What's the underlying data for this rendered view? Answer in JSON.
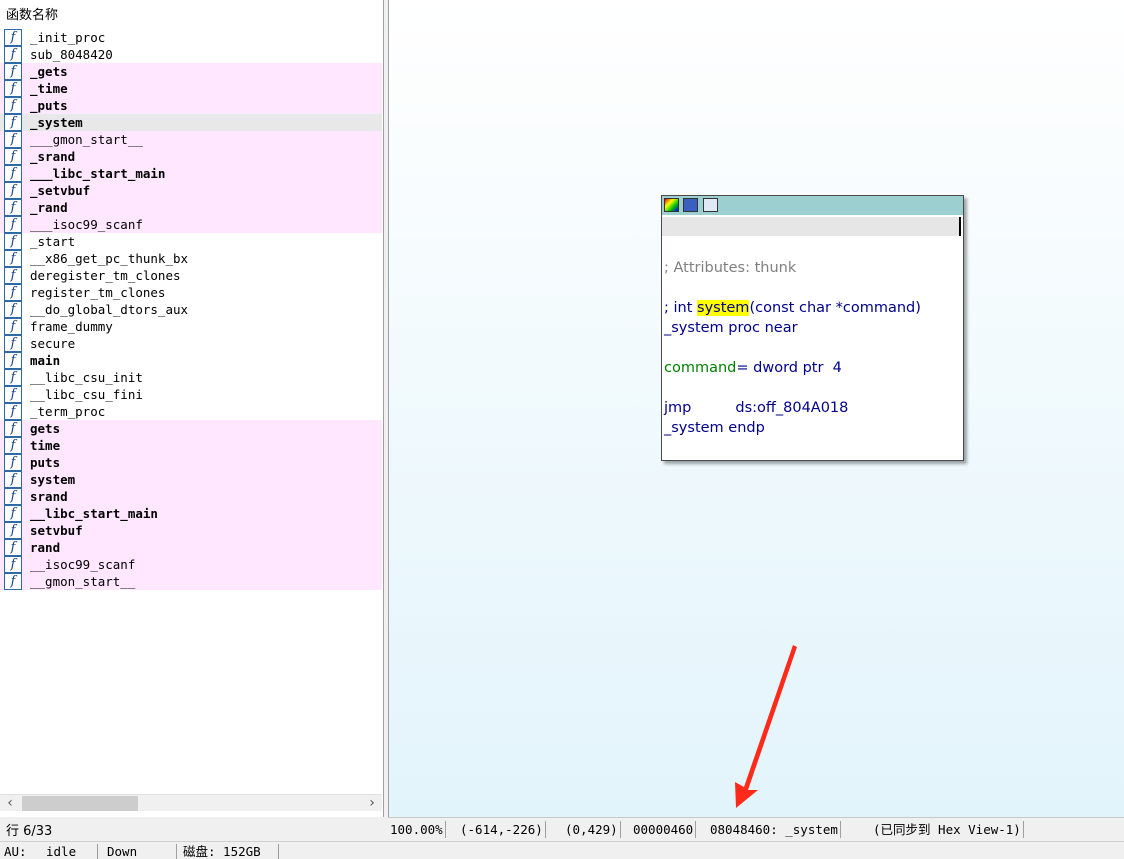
{
  "functions_panel": {
    "title": "函数名称",
    "row_indicator": "行 6/33",
    "items": [
      {
        "name": "_init_proc",
        "bold": false,
        "pink": false
      },
      {
        "name": "sub_8048420",
        "bold": false,
        "pink": false
      },
      {
        "name": "_gets",
        "bold": true,
        "pink": true
      },
      {
        "name": "_time",
        "bold": true,
        "pink": true
      },
      {
        "name": "_puts",
        "bold": true,
        "pink": true
      },
      {
        "name": "_system",
        "bold": true,
        "pink": true,
        "selected": true
      },
      {
        "name": "___gmon_start__",
        "bold": false,
        "pink": true
      },
      {
        "name": "_srand",
        "bold": true,
        "pink": true
      },
      {
        "name": "___libc_start_main",
        "bold": true,
        "pink": true
      },
      {
        "name": "_setvbuf",
        "bold": true,
        "pink": true
      },
      {
        "name": "_rand",
        "bold": true,
        "pink": true
      },
      {
        "name": "___isoc99_scanf",
        "bold": false,
        "pink": true
      },
      {
        "name": "_start",
        "bold": false,
        "pink": false
      },
      {
        "name": "__x86_get_pc_thunk_bx",
        "bold": false,
        "pink": false
      },
      {
        "name": "deregister_tm_clones",
        "bold": false,
        "pink": false
      },
      {
        "name": "register_tm_clones",
        "bold": false,
        "pink": false
      },
      {
        "name": "__do_global_dtors_aux",
        "bold": false,
        "pink": false
      },
      {
        "name": "frame_dummy",
        "bold": false,
        "pink": false
      },
      {
        "name": "secure",
        "bold": false,
        "pink": false
      },
      {
        "name": "main",
        "bold": true,
        "pink": false
      },
      {
        "name": "__libc_csu_init",
        "bold": false,
        "pink": false
      },
      {
        "name": "__libc_csu_fini",
        "bold": false,
        "pink": false
      },
      {
        "name": "_term_proc",
        "bold": false,
        "pink": false
      },
      {
        "name": "gets",
        "bold": true,
        "pink": true
      },
      {
        "name": "time",
        "bold": true,
        "pink": true
      },
      {
        "name": "puts",
        "bold": true,
        "pink": true
      },
      {
        "name": "system",
        "bold": true,
        "pink": true
      },
      {
        "name": "srand",
        "bold": true,
        "pink": true
      },
      {
        "name": "__libc_start_main",
        "bold": true,
        "pink": true
      },
      {
        "name": "setvbuf",
        "bold": true,
        "pink": true
      },
      {
        "name": "rand",
        "bold": true,
        "pink": true
      },
      {
        "name": "__isoc99_scanf",
        "bold": false,
        "pink": true
      },
      {
        "name": "__gmon_start__",
        "bold": false,
        "pink": true
      }
    ]
  },
  "code_node": {
    "attributes_comment": "; Attributes: thunk",
    "proto_prefix": "; int ",
    "proto_highlight": "system",
    "proto_suffix": "(const char *command)",
    "proc_line": "_system proc near",
    "arg_name": "command",
    "arg_rest": "= dword ptr  4",
    "jmp_instr": "jmp",
    "jmp_operand": "ds:off_804A018",
    "endp_line": "_system endp"
  },
  "graph_status": {
    "zoom": "100.00%",
    "coords": "(-614,-226)",
    "pos": "(0,429)",
    "file_offset": "00000460",
    "address": "08048460: _system",
    "sync": "(已同步到 Hex View-1)"
  },
  "bottom_bar": {
    "au_label": "AU:",
    "au_state": "idle",
    "direction": "Down",
    "disk": "磁盘: 152GB"
  },
  "colors": {
    "pink_row": "#ffe8ff",
    "highlight": "#ffff00",
    "arrow": "#ff2a1a",
    "node_titlebar": "#9cd0d0"
  }
}
